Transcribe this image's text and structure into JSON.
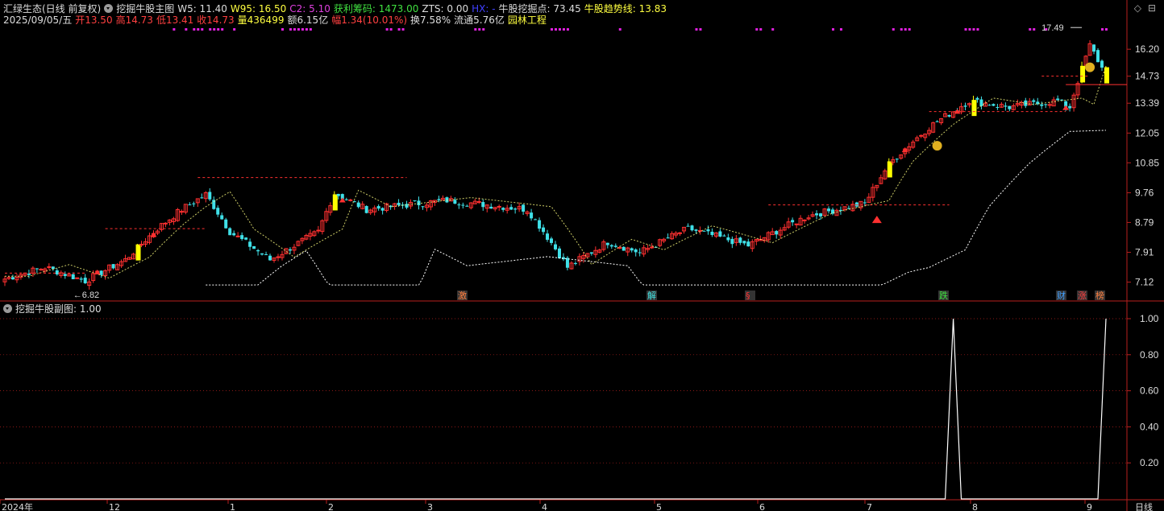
{
  "header": {
    "title": "汇绿生态(日线 前复权)",
    "indicator_name": "挖掘牛股主图",
    "w5_label": "W5: 11.40",
    "w95_label": "W95: 16.50",
    "c2_label": "C2: 5.10",
    "profit_label": "获利筹码: 1473.00",
    "zts_label": "ZTS: 0.00",
    "hx_label": "HX: -",
    "dig_label": "牛股挖掘点: 73.45",
    "trend_label": "牛股趋势线: 13.83"
  },
  "info": {
    "date": "2025/09/05/五",
    "open": "开13.50",
    "high": "高14.73",
    "low": "低13.41",
    "close": "收14.73",
    "volume": "量436499",
    "amount": "额6.15亿",
    "change": "幅1.34(10.01%)",
    "turnover": "换7.58%",
    "float": "流通5.76亿",
    "sector": "园林工程"
  },
  "sub_header": {
    "name": "挖掘牛股副图",
    "value": ": 1.00"
  },
  "icons": {
    "diamond": "◇",
    "minus": "⊟"
  },
  "colors": {
    "up": "#ff3030",
    "down": "#3fe0e8",
    "limit": "#ffff00",
    "dots": "#e020e0",
    "dashed": "#ffffff",
    "trend": "#ffff80",
    "axis": "#b8201e"
  },
  "chart_data": [
    {
      "type": "candlestick",
      "title": "挖掘牛股主图",
      "yticks": [
        16.2,
        14.73,
        13.39,
        12.05,
        10.85,
        9.76,
        8.79,
        7.91,
        7.12
      ],
      "ylim": [
        6.7,
        17.7
      ],
      "xticks": [
        "2024年",
        "12",
        "1",
        "2",
        "3",
        "4",
        "5",
        "6",
        "7",
        "8",
        "9"
      ],
      "period_label": "日线",
      "annotations": [
        {
          "text": "17.49",
          "value": 17.49
        },
        {
          "text": "6.82",
          "value": 6.82
        }
      ],
      "event_labels": [
        "激",
        "解",
        "§",
        "跌",
        "财",
        "涨",
        "榜"
      ],
      "waypoints": [
        {
          "i": 0,
          "c": 7.2
        },
        {
          "i": 10,
          "c": 7.5
        },
        {
          "i": 20,
          "c": 7.15
        },
        {
          "i": 30,
          "c": 7.7
        },
        {
          "i": 38,
          "c": 8.6
        },
        {
          "i": 44,
          "c": 9.2
        },
        {
          "i": 50,
          "c": 9.7
        },
        {
          "i": 56,
          "c": 8.5
        },
        {
          "i": 66,
          "c": 7.7
        },
        {
          "i": 78,
          "c": 8.5
        },
        {
          "i": 82,
          "c": 9.75
        },
        {
          "i": 90,
          "c": 9.2
        },
        {
          "i": 110,
          "c": 9.5
        },
        {
          "i": 130,
          "c": 9.2
        },
        {
          "i": 140,
          "c": 7.5
        },
        {
          "i": 150,
          "c": 8.2
        },
        {
          "i": 158,
          "c": 7.9
        },
        {
          "i": 170,
          "c": 8.6
        },
        {
          "i": 185,
          "c": 8.1
        },
        {
          "i": 200,
          "c": 9.0
        },
        {
          "i": 214,
          "c": 9.4
        },
        {
          "i": 220,
          "c": 10.8
        },
        {
          "i": 230,
          "c": 12.3
        },
        {
          "i": 240,
          "c": 13.5
        },
        {
          "i": 250,
          "c": 13.2
        },
        {
          "i": 262,
          "c": 13.5
        },
        {
          "i": 265,
          "c": 13.2
        },
        {
          "i": 270,
          "c": 16.4
        },
        {
          "i": 274,
          "c": 14.73
        }
      ],
      "count": 275
    },
    {
      "type": "line",
      "title": "挖掘牛股副图",
      "yticks": [
        1.0,
        0.8,
        0.6,
        0.4,
        0.2
      ],
      "ylim": [
        0,
        1.0
      ],
      "series": [
        {
          "x": [
            0,
            234,
            236,
            238,
            270,
            272,
            274
          ],
          "y": [
            0,
            0,
            1.0,
            0,
            0,
            0,
            1.0
          ]
        }
      ]
    }
  ]
}
